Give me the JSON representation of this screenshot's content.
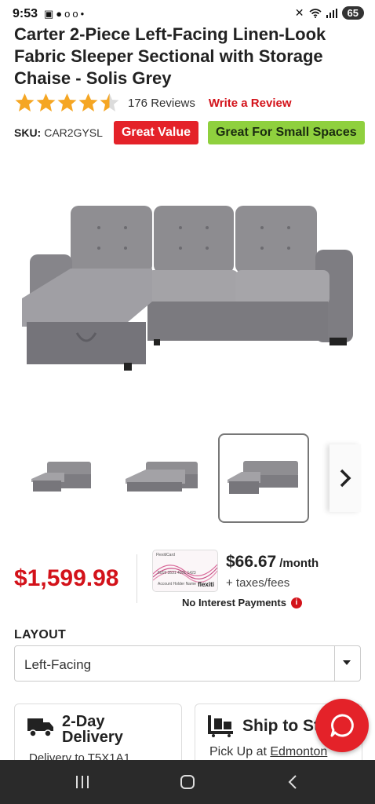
{
  "status_bar": {
    "time": "9:53",
    "left_icons": [
      "screenshot-icon",
      "message-icon",
      "voicemail-icon",
      "dot-icon"
    ],
    "right_icons": [
      "mute-icon",
      "wifi-icon",
      "signal-icon"
    ],
    "battery": "65"
  },
  "product": {
    "title": "Carter 2-Piece Left-Facing Linen-Look Fabric Sleeper Sectional with Storage Chaise - Solis Grey",
    "rating_stars": 4.5,
    "reviews_text": "176 Reviews",
    "write_review": "Write a Review",
    "sku_label": "SKU:",
    "sku_value": "CAR2GYSL",
    "badges": [
      "Great Value",
      "Great For Small Spaces"
    ]
  },
  "gallery": {
    "thumbnail_count": 4,
    "selected_index": 2
  },
  "pricing": {
    "price": "$1,599.98",
    "card": {
      "brand_small": "FlexitiCard",
      "number": "5019 3531 4001 1423",
      "name_line": "Account Holder Name",
      "brand": "flexiti"
    },
    "monthly": "$66.67",
    "monthly_unit": "/month",
    "taxes": "+ taxes/fees",
    "no_interest": "No Interest Payments"
  },
  "layout": {
    "label": "LAYOUT",
    "selected": "Left-Facing"
  },
  "delivery": {
    "title_line1": "2-Day",
    "title_line2": "Delivery",
    "subtitle": "Delivery to T5X1A1"
  },
  "ship": {
    "title": "Ship to Store",
    "subtitle_prefix": "Pick Up at ",
    "store": "Edmonton"
  },
  "colors": {
    "brand_red": "#e42229",
    "price_red": "#d3121a",
    "badge_green": "#8fd03e",
    "star_gold": "#f5a623"
  }
}
